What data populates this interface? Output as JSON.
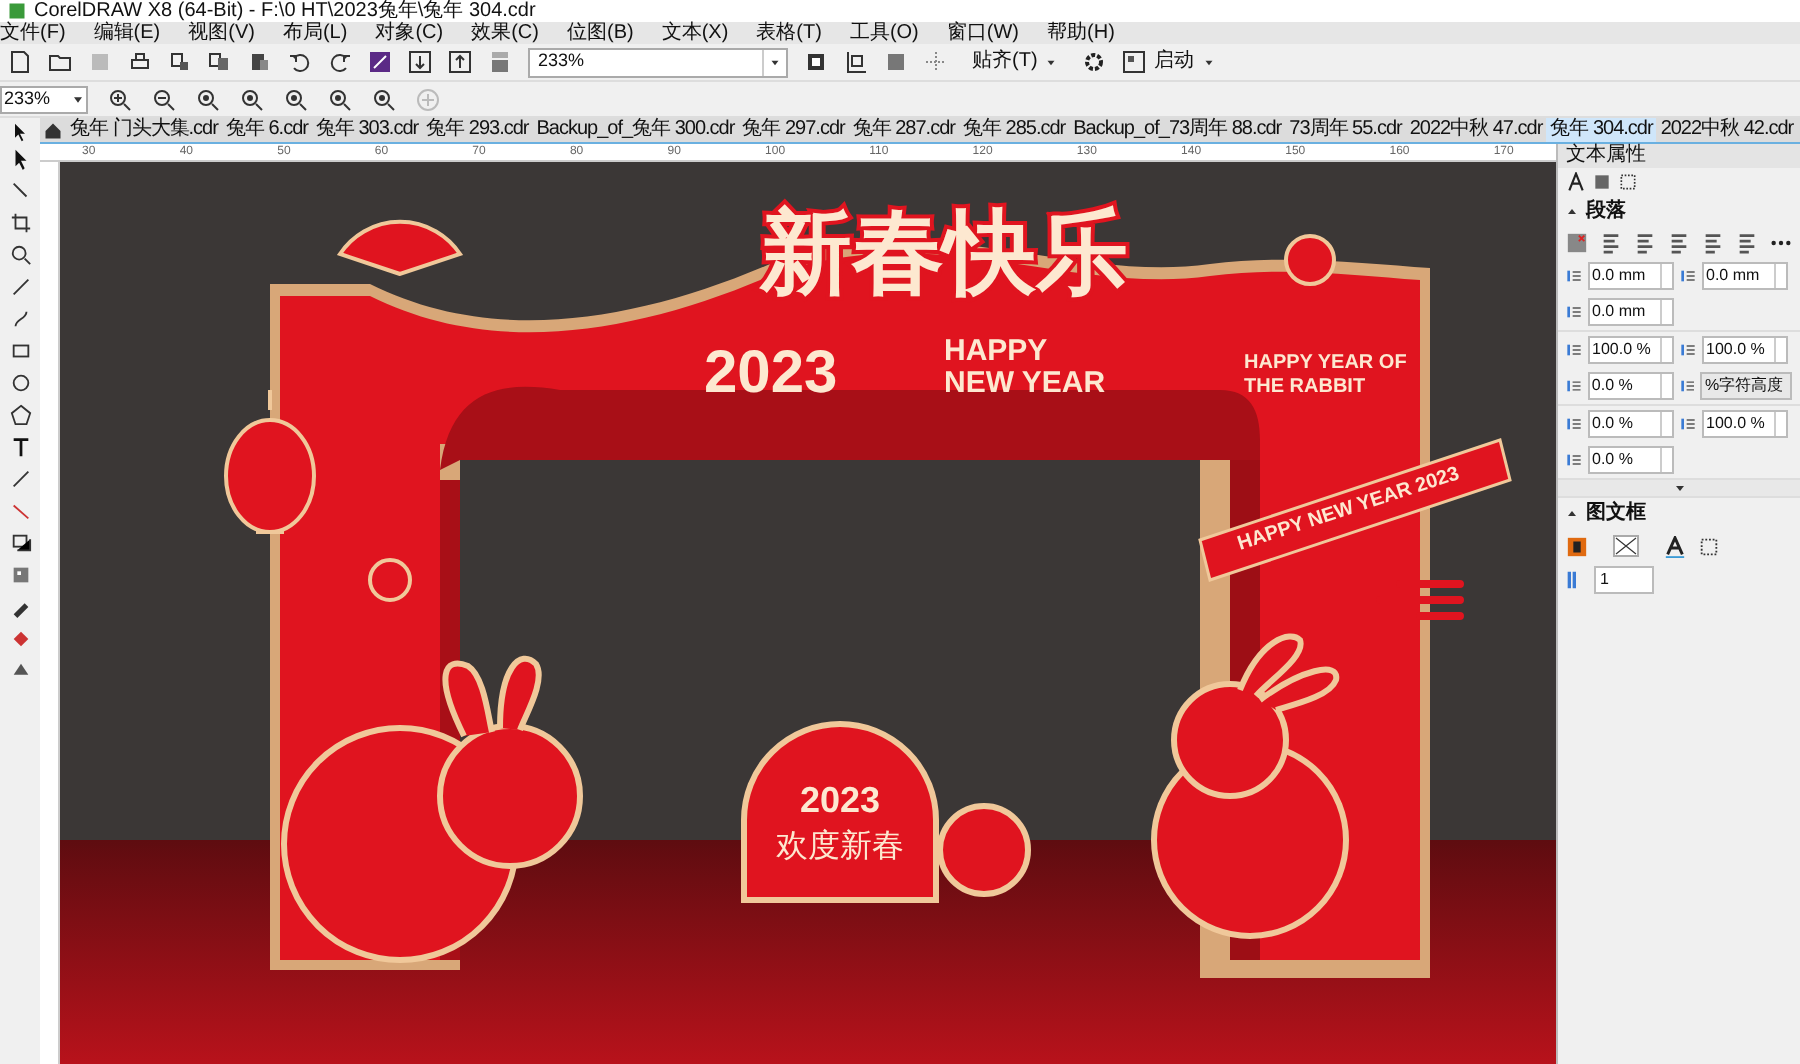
{
  "window": {
    "title": "CorelDRAW X8 (64-Bit) - F:\\0 HT\\2023兔年\\兔年 304.cdr"
  },
  "menu": [
    "文件(F)",
    "编辑(E)",
    "视图(V)",
    "布局(L)",
    "对象(C)",
    "效果(C)",
    "位图(B)",
    "文本(X)",
    "表格(T)",
    "工具(O)",
    "窗口(W)",
    "帮助(H)"
  ],
  "toolbar": {
    "zoom": "233%",
    "snap": "贴齐(T)",
    "launch": "启动"
  },
  "zoom_toolbar": {
    "zoom": "233%"
  },
  "tabs": [
    {
      "label": "兔年 门头大集.cdr",
      "selected": false
    },
    {
      "label": "兔年 6.cdr",
      "selected": false
    },
    {
      "label": "兔年 303.cdr",
      "selected": false
    },
    {
      "label": "兔年 293.cdr",
      "selected": false
    },
    {
      "label": "Backup_of_兔年 300.cdr",
      "selected": false
    },
    {
      "label": "兔年 297.cdr",
      "selected": false
    },
    {
      "label": "兔年 287.cdr",
      "selected": false
    },
    {
      "label": "兔年 285.cdr",
      "selected": false
    },
    {
      "label": "Backup_of_73周年 88.cdr",
      "selected": false
    },
    {
      "label": "73周年 55.cdr",
      "selected": false
    },
    {
      "label": "2022中秋 47.cdr",
      "selected": false
    },
    {
      "label": "兔年 304.cdr",
      "selected": true
    },
    {
      "label": "2022中秋 42.cdr",
      "selected": false
    }
  ],
  "ruler": {
    "labels": [
      "30",
      "40",
      "50",
      "60",
      "70",
      "80",
      "90",
      "100",
      "110",
      "120",
      "130",
      "140",
      "150",
      "160",
      "170"
    ]
  },
  "artwork": {
    "title": "新春快乐",
    "year": "2023",
    "greeting": [
      "HAPPY",
      "NEW YEAR"
    ],
    "rabbit_text": [
      "HAPPY YEAR OF",
      "THE RABBIT"
    ],
    "ribbon": "HAPPY NEW YEAR 2023",
    "sign": {
      "year": "2023",
      "text": "欢度新春"
    }
  },
  "panel": {
    "title": "文本属性",
    "paragraph": {
      "heading": "段落",
      "expanded": true,
      "rows": [
        [
          {
            "kind": "spin",
            "value": "0.0 mm"
          },
          {
            "kind": "spin",
            "value": "0.0 mm"
          }
        ],
        [
          {
            "kind": "spin",
            "value": "0.0 mm"
          }
        ],
        [
          {
            "kind": "spin",
            "value": "100.0 %"
          },
          {
            "kind": "spin",
            "value": "100.0 %"
          }
        ],
        [
          {
            "kind": "spin",
            "value": "0.0 %"
          },
          {
            "kind": "dropdown",
            "value": "%字符高度"
          }
        ],
        [
          {
            "kind": "spin",
            "value": "0.0 %"
          },
          {
            "kind": "spin",
            "value": "100.0 %"
          }
        ],
        [
          {
            "kind": "spin",
            "value": "0.0 %"
          }
        ]
      ]
    },
    "frame": {
      "heading": "图文框",
      "expanded": true,
      "columns": "1"
    }
  }
}
